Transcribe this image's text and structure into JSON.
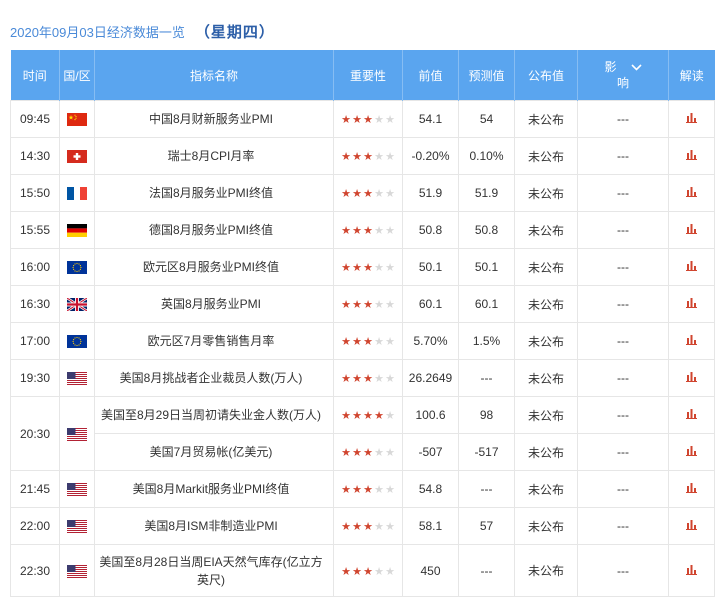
{
  "header": {
    "date_title": "2020年09月03日经济数据一览",
    "weekday": "（星期四）"
  },
  "columns": {
    "time": "时间",
    "country": "国/区",
    "indicator": "指标名称",
    "importance": "重要性",
    "previous": "前值",
    "forecast": "预测值",
    "actual": "公布值",
    "impact_1": "影",
    "impact_2": "响",
    "analysis": "解读"
  },
  "rows": [
    {
      "time": "09:45",
      "flag": "china-flag",
      "name": "中国8月财新服务业PMI",
      "stars": 3,
      "previous": "54.1",
      "forecast": "54",
      "actual": "未公布",
      "impact": "---"
    },
    {
      "time": "14:30",
      "flag": "switzerland-flag",
      "name": "瑞士8月CPI月率",
      "stars": 3,
      "previous": "-0.20%",
      "forecast": "0.10%",
      "actual": "未公布",
      "impact": "---"
    },
    {
      "time": "15:50",
      "flag": "france-flag",
      "name": "法国8月服务业PMI终值",
      "stars": 3,
      "previous": "51.9",
      "forecast": "51.9",
      "actual": "未公布",
      "impact": "---"
    },
    {
      "time": "15:55",
      "flag": "germany-flag",
      "name": "德国8月服务业PMI终值",
      "stars": 3,
      "previous": "50.8",
      "forecast": "50.8",
      "actual": "未公布",
      "impact": "---"
    },
    {
      "time": "16:00",
      "flag": "eu-flag",
      "name": "欧元区8月服务业PMI终值",
      "stars": 3,
      "previous": "50.1",
      "forecast": "50.1",
      "actual": "未公布",
      "impact": "---"
    },
    {
      "time": "16:30",
      "flag": "uk-flag",
      "name": "英国8月服务业PMI",
      "stars": 3,
      "previous": "60.1",
      "forecast": "60.1",
      "actual": "未公布",
      "impact": "---"
    },
    {
      "time": "17:00",
      "flag": "eu-flag",
      "name": "欧元区7月零售销售月率",
      "stars": 3,
      "previous": "5.70%",
      "forecast": "1.5%",
      "actual": "未公布",
      "impact": "---"
    },
    {
      "time": "19:30",
      "flag": "us-flag",
      "name": "美国8月挑战者企业裁员人数(万人)",
      "stars": 3,
      "previous": "26.2649",
      "forecast": "---",
      "actual": "未公布",
      "impact": "---"
    },
    {
      "time": "20:30",
      "flag": "us-flag",
      "name": "美国至8月29日当周初请失业金人数(万人)",
      "stars": 4,
      "previous": "100.6",
      "forecast": "98",
      "actual": "未公布",
      "impact": "---"
    },
    {
      "time": "",
      "flag": "",
      "name": "美国7月贸易帐(亿美元)",
      "stars": 3,
      "previous": "-507",
      "forecast": "-517",
      "actual": "未公布",
      "impact": "---"
    },
    {
      "time": "21:45",
      "flag": "us-flag",
      "name": "美国8月Markit服务业PMI终值",
      "stars": 3,
      "previous": "54.8",
      "forecast": "---",
      "actual": "未公布",
      "impact": "---"
    },
    {
      "time": "22:00",
      "flag": "us-flag",
      "name": "美国8月ISM非制造业PMI",
      "stars": 3,
      "previous": "58.1",
      "forecast": "57",
      "actual": "未公布",
      "impact": "---"
    },
    {
      "time": "22:30",
      "flag": "us-flag",
      "name": "美国至8月28日当周EIA天然气库存(亿立方英尺)",
      "stars": 3,
      "previous": "450",
      "forecast": "---",
      "actual": "未公布",
      "impact": "---"
    }
  ],
  "colors": {
    "header_bg": "#5aa5ef",
    "accent_red": "#d0452f",
    "title_blue": "#4a8ad8",
    "star_off": "#d8d8d8"
  }
}
